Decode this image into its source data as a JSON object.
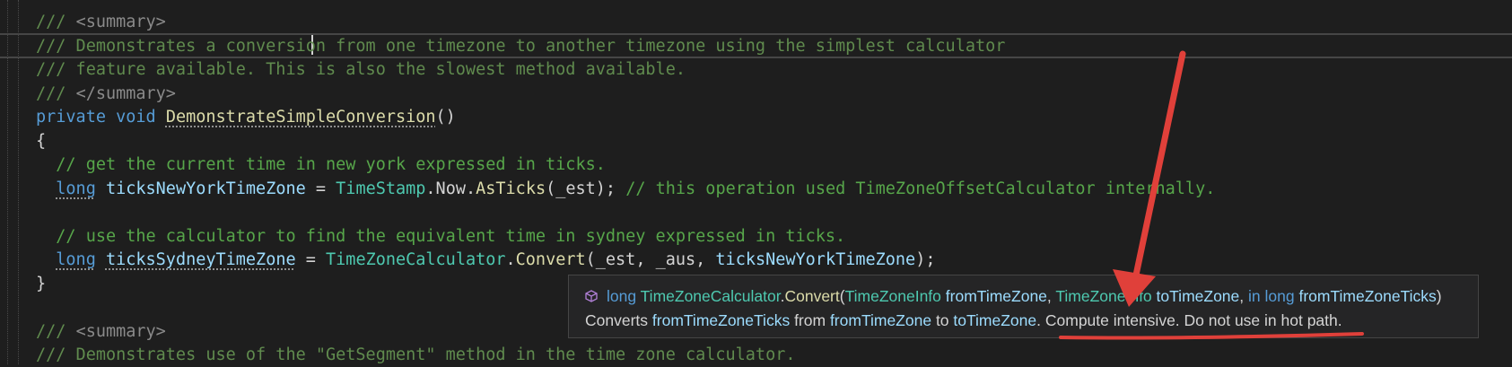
{
  "editor": {
    "lines": [
      [
        {
          "t": "/// ",
          "c": "c-doc"
        },
        {
          "t": "<summary>",
          "c": "c-xml"
        }
      ],
      [
        {
          "t": "/// Demonstrates a conversion from one timezone to another timezone using the simplest calculator",
          "c": "c-doc"
        }
      ],
      [
        {
          "t": "/// feature available. This is also the slowest method available.",
          "c": "c-doc"
        }
      ],
      [
        {
          "t": "/// ",
          "c": "c-doc"
        },
        {
          "t": "</summary>",
          "c": "c-xml"
        }
      ],
      [
        {
          "t": "private",
          "c": "c-kw"
        },
        {
          "t": " ",
          "c": "c-id"
        },
        {
          "t": "void",
          "c": "c-kw"
        },
        {
          "t": " ",
          "c": "c-id"
        },
        {
          "t": "DemonstrateSimpleConversion",
          "c": "c-fn dotted"
        },
        {
          "t": "()",
          "c": "c-id"
        }
      ],
      [
        {
          "t": "{",
          "c": "c-id"
        }
      ],
      [
        {
          "t": "  // get the current time in new york expressed in ticks.",
          "c": "c-com"
        }
      ],
      [
        {
          "t": "  ",
          "c": "c-id"
        },
        {
          "t": "long",
          "c": "c-kw dotted"
        },
        {
          "t": " ",
          "c": "c-id"
        },
        {
          "t": "ticksNewYorkTimeZone",
          "c": "c-var"
        },
        {
          "t": " = ",
          "c": "c-id"
        },
        {
          "t": "TimeStamp",
          "c": "c-ty"
        },
        {
          "t": ".Now.",
          "c": "c-id"
        },
        {
          "t": "AsTicks",
          "c": "c-fn"
        },
        {
          "t": "(_est); ",
          "c": "c-id"
        },
        {
          "t": "// this operation used TimeZoneOffsetCalculator internally.",
          "c": "c-com"
        }
      ],
      [],
      [
        {
          "t": "  // use the calculator to find the equivalent time in sydney expressed in ticks.",
          "c": "c-com"
        }
      ],
      [
        {
          "t": "  ",
          "c": "c-id"
        },
        {
          "t": "long",
          "c": "c-kw dotted"
        },
        {
          "t": " ",
          "c": "c-id"
        },
        {
          "t": "ticksSydneyTimeZone",
          "c": "c-var dotted"
        },
        {
          "t": " = ",
          "c": "c-id"
        },
        {
          "t": "TimeZoneCalculator",
          "c": "c-ty"
        },
        {
          "t": ".",
          "c": "c-id"
        },
        {
          "t": "Convert",
          "c": "c-fn"
        },
        {
          "t": "(_est, _aus, ",
          "c": "c-id"
        },
        {
          "t": "ticksNewYorkTimeZone",
          "c": "c-var"
        },
        {
          "t": ");",
          "c": "c-id"
        }
      ],
      [
        {
          "t": "}",
          "c": "c-id"
        }
      ],
      [],
      [
        {
          "t": "/// ",
          "c": "c-doc"
        },
        {
          "t": "<summary>",
          "c": "c-xml"
        }
      ],
      [
        {
          "t": "/// Demonstrates use of the \"GetSegment\" method in the time zone calculator.",
          "c": "c-doc"
        }
      ]
    ]
  },
  "tooltip": {
    "icon": "method-cube-icon",
    "signature": [
      {
        "t": "long",
        "c": "t-kw"
      },
      {
        "t": " ",
        "c": "t-txt"
      },
      {
        "t": "TimeZoneCalculator",
        "c": "t-ty"
      },
      {
        "t": ".",
        "c": "t-txt"
      },
      {
        "t": "Convert",
        "c": "t-fn"
      },
      {
        "t": "(",
        "c": "t-txt"
      },
      {
        "t": "TimeZoneInfo",
        "c": "t-ty"
      },
      {
        "t": " ",
        "c": "t-txt"
      },
      {
        "t": "fromTimeZone",
        "c": "t-var"
      },
      {
        "t": ", ",
        "c": "t-txt"
      },
      {
        "t": "TimeZoneInfo",
        "c": "t-ty"
      },
      {
        "t": " ",
        "c": "t-txt"
      },
      {
        "t": "toTimeZone",
        "c": "t-var"
      },
      {
        "t": ", ",
        "c": "t-txt"
      },
      {
        "t": "in",
        "c": "t-kw"
      },
      {
        "t": " ",
        "c": "t-txt"
      },
      {
        "t": "long",
        "c": "t-kw"
      },
      {
        "t": " ",
        "c": "t-txt"
      },
      {
        "t": "fromTimeZoneTicks",
        "c": "t-var"
      },
      {
        "t": ")",
        "c": "t-txt"
      }
    ],
    "description": [
      {
        "t": "Converts ",
        "c": "t-txt"
      },
      {
        "t": "fromTimeZoneTicks",
        "c": "t-var"
      },
      {
        "t": " from ",
        "c": "t-txt"
      },
      {
        "t": "fromTimeZone",
        "c": "t-var"
      },
      {
        "t": " to ",
        "c": "t-txt"
      },
      {
        "t": "toTimeZone",
        "c": "t-var"
      },
      {
        "t": ". Compute intensive. Do not use in hot path.",
        "c": "t-txt"
      }
    ]
  },
  "colors": {
    "background": "#1e1e1e",
    "annotation": "#e0403a"
  }
}
